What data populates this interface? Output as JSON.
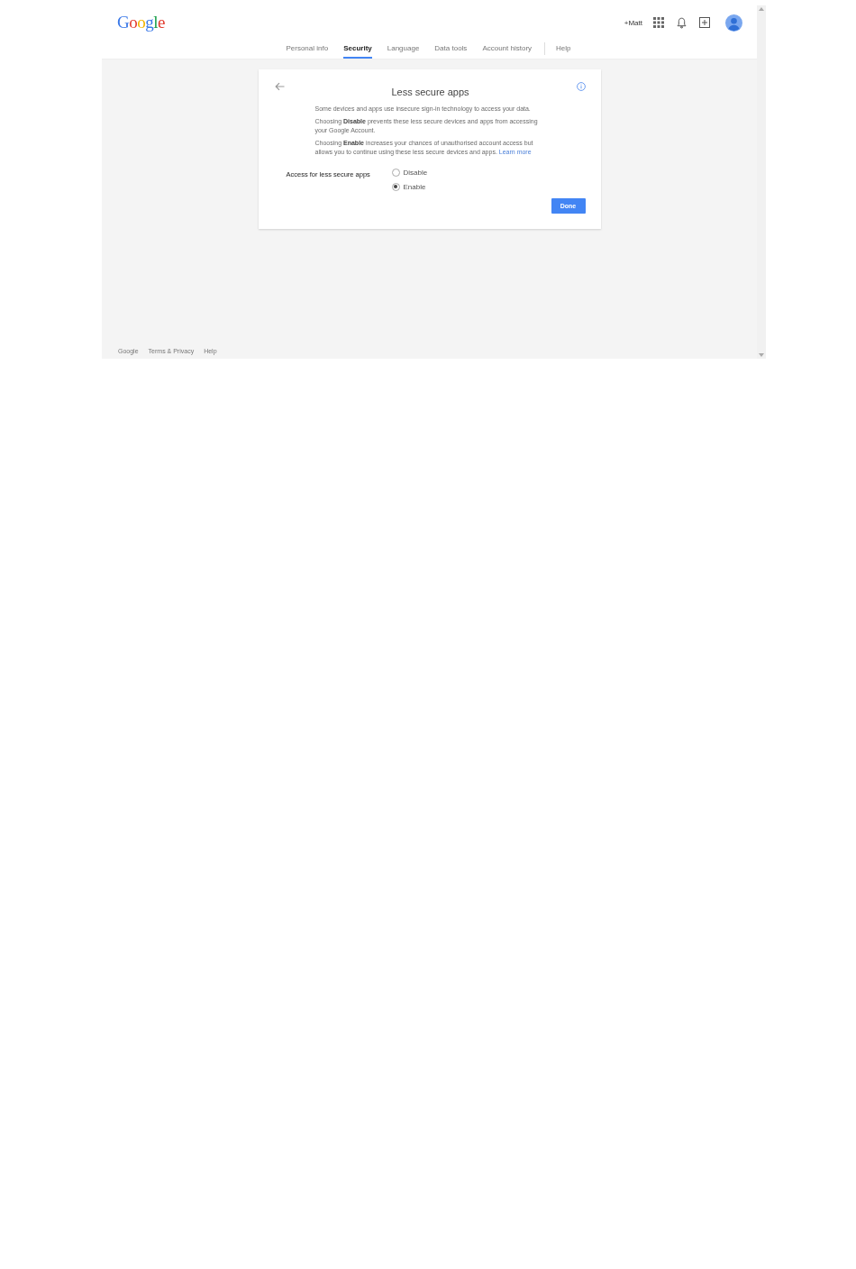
{
  "header": {
    "logo": "Google",
    "user_link": "+Matt"
  },
  "tabs": [
    {
      "label": "Personal info",
      "selected": false
    },
    {
      "label": "Security",
      "selected": true
    },
    {
      "label": "Language",
      "selected": false
    },
    {
      "label": "Data tools",
      "selected": false
    },
    {
      "label": "Account history",
      "selected": false
    },
    {
      "label": "Help",
      "selected": false
    }
  ],
  "card": {
    "title": "Less secure apps",
    "paragraphs": [
      {
        "text": "Some devices and apps use insecure sign-in technology to access your data."
      },
      {
        "text": "Choosing **Disable** prevents these less secure devices and apps from accessing your Google Account."
      },
      {
        "text": "Choosing **Enable** increases your chances of unauthorised account access but allows you to continue using these less secure devices and apps.",
        "link": "Learn more"
      }
    ],
    "setting_label": "Access for less secure apps",
    "options": [
      {
        "label": "Disable",
        "selected": false
      },
      {
        "label": "Enable",
        "selected": true
      }
    ],
    "button": "Done"
  },
  "footer": {
    "links": [
      "Google",
      "Terms & Privacy",
      "Help"
    ]
  }
}
